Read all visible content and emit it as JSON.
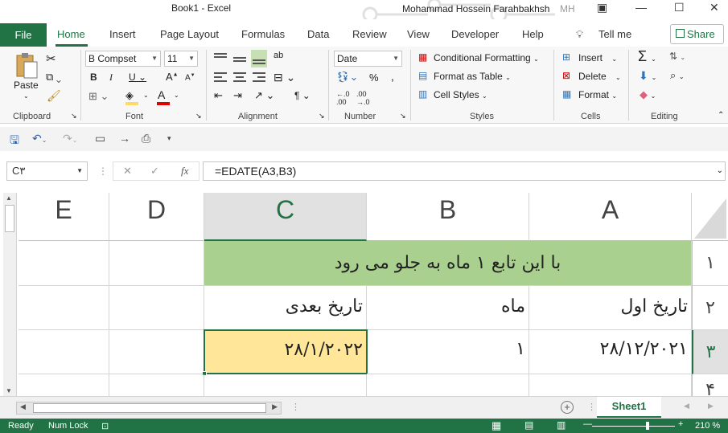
{
  "window": {
    "title": "Book1  -  Excel",
    "user": "Mohammad Hossein Farahbakhsh",
    "initials": "MH"
  },
  "tabs": {
    "file": "File",
    "items": [
      "Home",
      "Insert",
      "Page Layout",
      "Formulas",
      "Data",
      "Review",
      "View",
      "Developer",
      "Help"
    ],
    "active": "Home",
    "tell_me": "Tell me",
    "share": "Share"
  },
  "ribbon": {
    "clipboard": {
      "label": "Clipboard",
      "paste": "Paste"
    },
    "font": {
      "label": "Font",
      "name": "B Compset",
      "size": "11"
    },
    "alignment": {
      "label": "Alignment"
    },
    "number": {
      "label": "Number",
      "format": "Date"
    },
    "styles": {
      "label": "Styles",
      "conditional": "Conditional Formatting",
      "format_table": "Format as Table",
      "cell_styles": "Cell Styles"
    },
    "cells": {
      "label": "Cells",
      "insert": "Insert",
      "delete": "Delete",
      "format": "Format"
    },
    "editing": {
      "label": "Editing"
    }
  },
  "formula_bar": {
    "name_box": "C۳",
    "fx": "fx",
    "formula": "=EDATE(A3,B3)"
  },
  "grid": {
    "columns": [
      "E",
      "D",
      "C",
      "B",
      "A"
    ],
    "selected_column": "C",
    "rows": [
      "۱",
      "۲",
      "۳",
      "۴"
    ],
    "selected_row": "۳",
    "title_row": "با این تابع ۱ ماه به جلو می رود",
    "headers": {
      "a": "تاریخ اول",
      "b": "ماه",
      "c": "تاریخ بعدی"
    },
    "values": {
      "a": "۲۸/۱۲/۲۰۲۱",
      "b": "۱",
      "c": "۲۸/۱/۲۰۲۲"
    }
  },
  "sheets": {
    "active": "Sheet1"
  },
  "status": {
    "ready": "Ready",
    "num_lock": "Num Lock",
    "zoom": "210 %"
  },
  "colors": {
    "accent": "#217346",
    "title_fill": "#a9d08e",
    "active_cell_fill": "#ffe699"
  }
}
